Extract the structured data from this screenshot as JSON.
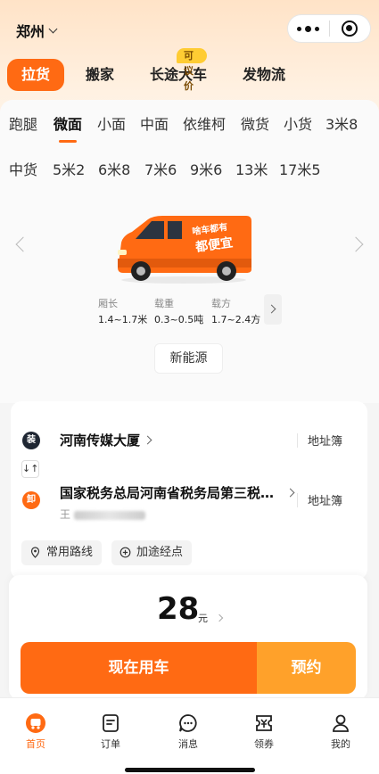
{
  "header": {
    "city": "郑州"
  },
  "service_tabs": [
    {
      "label": "拉货",
      "active": true
    },
    {
      "label": "搬家",
      "active": false
    },
    {
      "label": "长途大车",
      "active": false,
      "badge": "可议价"
    },
    {
      "label": "发物流",
      "active": false
    }
  ],
  "vehicle_tabs_row1": [
    "跑腿",
    "微面",
    "小面",
    "中面",
    "依维柯",
    "微货",
    "小货",
    "3米8"
  ],
  "vehicle_tabs_row2": [
    "中货",
    "5米2",
    "6米8",
    "7米6",
    "9米6",
    "13米",
    "17米5"
  ],
  "selected_vehicle": "微面",
  "van_graphic_text": {
    "line1": "啥车都有",
    "line2": "都便宜"
  },
  "specs": [
    {
      "label": "厢长",
      "value": "1.4~1.7米"
    },
    {
      "label": "载重",
      "value": "0.3~0.5吨"
    },
    {
      "label": "载方",
      "value": "1.7~2.4方"
    }
  ],
  "energy_button": "新能源",
  "route": {
    "load_icon": "装",
    "unload_icon": "卸",
    "swap_icon": "↓↑",
    "load_address": "河南传媒大厦",
    "unload_address": "国家税务总局河南省税务局第三税…",
    "unload_sub_prefix": "王",
    "address_book": "地址簿",
    "chips": [
      "常用路线",
      "加途经点"
    ]
  },
  "order": {
    "price": "28",
    "unit": "元",
    "now_button": "现在用车",
    "book_button": "预约"
  },
  "tabbar": [
    {
      "label": "首页",
      "icon": "home-icon",
      "active": true
    },
    {
      "label": "订单",
      "icon": "orders-icon",
      "active": false
    },
    {
      "label": "消息",
      "icon": "message-icon",
      "active": false
    },
    {
      "label": "领券",
      "icon": "coupon-icon",
      "active": false
    },
    {
      "label": "我的",
      "icon": "profile-icon",
      "active": false
    }
  ],
  "colors": {
    "accent": "#ff6a13",
    "secondary": "#ffa12a",
    "badge": "#ffcc33"
  }
}
